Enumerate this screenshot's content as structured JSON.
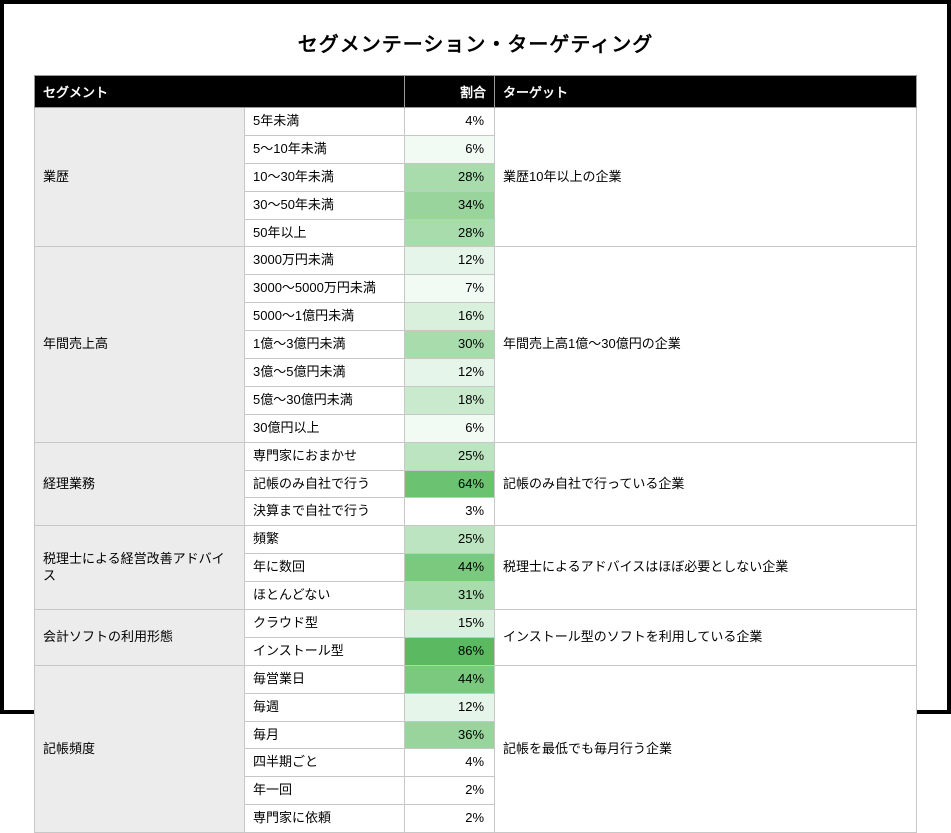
{
  "title": "セグメンテーション・ターゲティング",
  "headers": {
    "segment": "セグメント",
    "ratio": "割合",
    "target": "ターゲット"
  },
  "groups": [
    {
      "name": "業歴",
      "target": "業歴10年以上の企業",
      "rows": [
        {
          "label": "5年未満",
          "pct": "4%",
          "shade": "g0"
        },
        {
          "label": "5〜10年未満",
          "pct": "6%",
          "shade": "g5"
        },
        {
          "label": "10〜30年未満",
          "pct": "28%",
          "shade": "g30"
        },
        {
          "label": "30〜50年未満",
          "pct": "34%",
          "shade": "g35"
        },
        {
          "label": "50年以上",
          "pct": "28%",
          "shade": "g30"
        }
      ]
    },
    {
      "name": "年間売上高",
      "target": "年間売上高1億〜30億円の企業",
      "rows": [
        {
          "label": "3000万円未満",
          "pct": "12%",
          "shade": "g10"
        },
        {
          "label": "3000〜5000万円未満",
          "pct": "7%",
          "shade": "g5"
        },
        {
          "label": "5000〜1億円未満",
          "pct": "16%",
          "shade": "g15"
        },
        {
          "label": "1億〜3億円未満",
          "pct": "30%",
          "shade": "g30"
        },
        {
          "label": "3億〜5億円未満",
          "pct": "12%",
          "shade": "g10"
        },
        {
          "label": "5億〜30億円未満",
          "pct": "18%",
          "shade": "g20"
        },
        {
          "label": "30億円以上",
          "pct": "6%",
          "shade": "g5"
        }
      ]
    },
    {
      "name": "経理業務",
      "target": "記帳のみ自社で行っている企業",
      "rows": [
        {
          "label": "専門家におまかせ",
          "pct": "25%",
          "shade": "g25"
        },
        {
          "label": "記帳のみ自社で行う",
          "pct": "64%",
          "shade": "g60"
        },
        {
          "label": "決算まで自社で行う",
          "pct": "3%",
          "shade": "g0"
        }
      ]
    },
    {
      "name": "税理士による経営改善アドバイス",
      "target": "税理士によるアドバイスはほぼ必要としない企業",
      "rows": [
        {
          "label": "頻繁",
          "pct": "25%",
          "shade": "g25"
        },
        {
          "label": "年に数回",
          "pct": "44%",
          "shade": "g45"
        },
        {
          "label": "ほとんどない",
          "pct": "31%",
          "shade": "g30"
        }
      ]
    },
    {
      "name": "会計ソフトの利用形態",
      "target": "インストール型のソフトを利用している企業",
      "rows": [
        {
          "label": "クラウド型",
          "pct": "15%",
          "shade": "g15"
        },
        {
          "label": "インストール型",
          "pct": "86%",
          "shade": "g85"
        }
      ]
    },
    {
      "name": "記帳頻度",
      "target": "記帳を最低でも毎月行う企業",
      "rows": [
        {
          "label": "毎営業日",
          "pct": "44%",
          "shade": "g45"
        },
        {
          "label": "毎週",
          "pct": "12%",
          "shade": "g10"
        },
        {
          "label": "毎月",
          "pct": "36%",
          "shade": "g35"
        },
        {
          "label": "四半期ごと",
          "pct": "4%",
          "shade": "g0"
        },
        {
          "label": "年一回",
          "pct": "2%",
          "shade": "g0"
        },
        {
          "label": "専門家に依頼",
          "pct": "2%",
          "shade": "g0"
        }
      ]
    }
  ]
}
